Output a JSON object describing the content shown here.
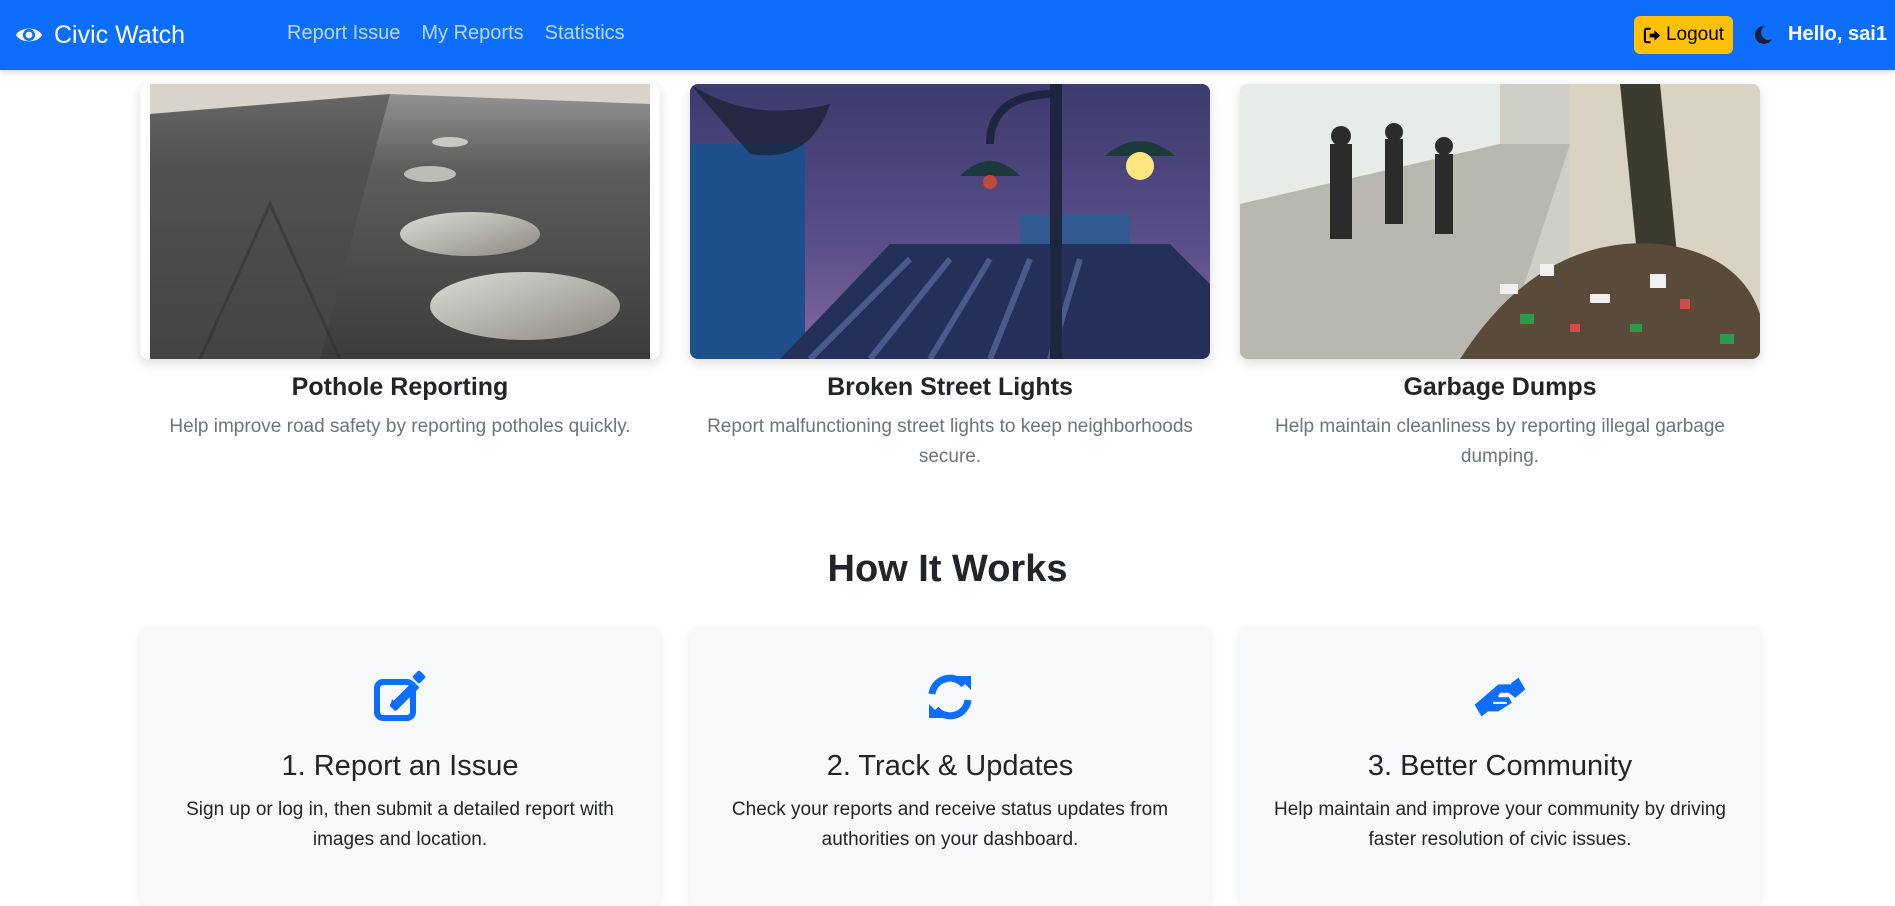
{
  "navbar": {
    "brand": "Civic Watch",
    "links": [
      "Report Issue",
      "My Reports",
      "Statistics"
    ],
    "logout_label": "Logout",
    "greeting": "Hello, sai1",
    "color": "#0d6efd"
  },
  "features": [
    {
      "title": "Pothole Reporting",
      "description": "Help improve road safety by reporting potholes quickly."
    },
    {
      "title": "Broken Street Lights",
      "description": "Report malfunctioning street lights to keep neighborhoods secure."
    },
    {
      "title": "Garbage Dumps",
      "description": "Help maintain cleanliness by reporting illegal garbage dumping."
    }
  ],
  "how_it_works": {
    "title": "How It Works",
    "steps": [
      {
        "icon": "edit-icon",
        "title": "1. Report an Issue",
        "description": "Sign up or log in, then submit a detailed report with images and location."
      },
      {
        "icon": "sync-icon",
        "title": "2. Track & Updates",
        "description": "Check your reports and receive status updates from authorities on your dashboard."
      },
      {
        "icon": "handshake-icon",
        "title": "3. Better Community",
        "description": "Help maintain and improve your community by driving faster resolution of civic issues."
      }
    ]
  },
  "colors": {
    "primary": "#0d6efd",
    "warning": "#ffc107",
    "muted": "#6c757d"
  }
}
